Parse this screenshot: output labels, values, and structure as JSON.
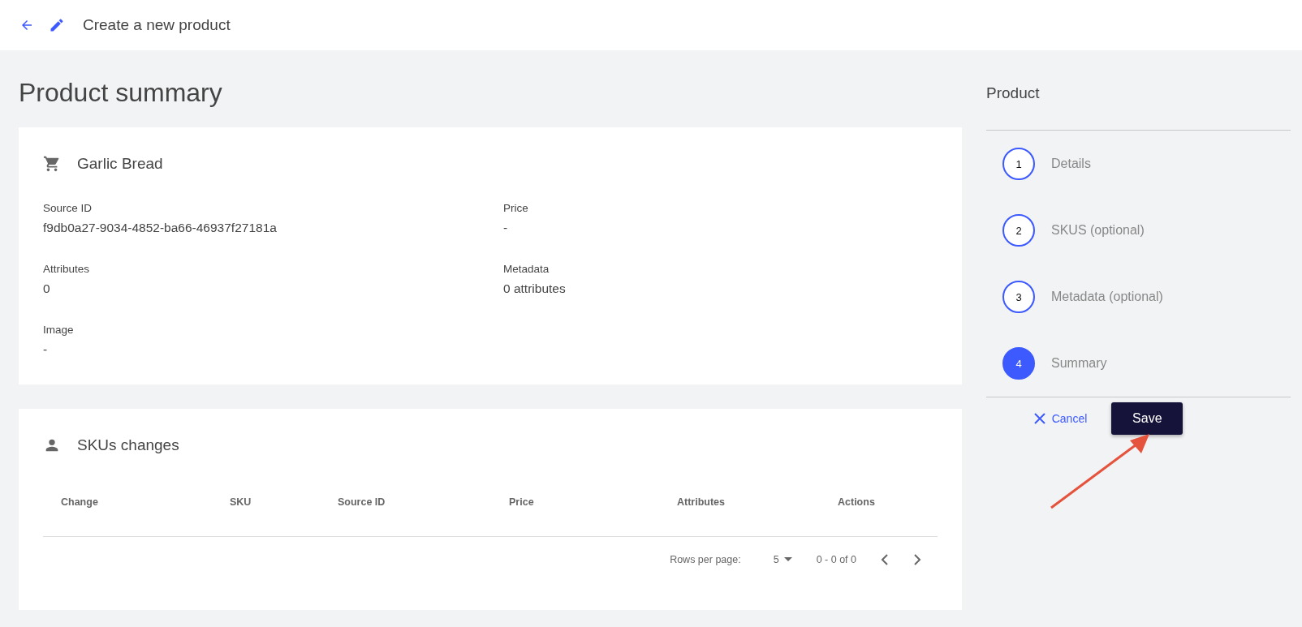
{
  "header": {
    "title": "Create a new product"
  },
  "page_title": "Product summary",
  "product_card": {
    "name": "Garlic Bread",
    "fields": [
      {
        "label": "Source ID",
        "value": "f9db0a27-9034-4852-ba66-46937f27181a"
      },
      {
        "label": "Price",
        "value": "-"
      },
      {
        "label": "Attributes",
        "value": "0"
      },
      {
        "label": "Metadata",
        "value": "0 attributes"
      },
      {
        "label": "Image",
        "value": "-"
      }
    ]
  },
  "skus_card": {
    "title": "SKUs changes",
    "columns": [
      "Change",
      "SKU",
      "Source ID",
      "Price",
      "Attributes",
      "Actions"
    ],
    "pagination": {
      "rows_per_page_label": "Rows per page:",
      "rows_per_page": "5",
      "range": "0 - 0 of 0"
    }
  },
  "stepper": {
    "title": "Product",
    "steps": [
      {
        "number": "1",
        "label": "Details",
        "selected": false
      },
      {
        "number": "2",
        "label": "SKUS (optional)",
        "selected": false
      },
      {
        "number": "3",
        "label": "Metadata (optional)",
        "selected": false
      },
      {
        "number": "4",
        "label": "Summary",
        "selected": true
      }
    ]
  },
  "actions": {
    "cancel": "Cancel",
    "save": "Save"
  }
}
